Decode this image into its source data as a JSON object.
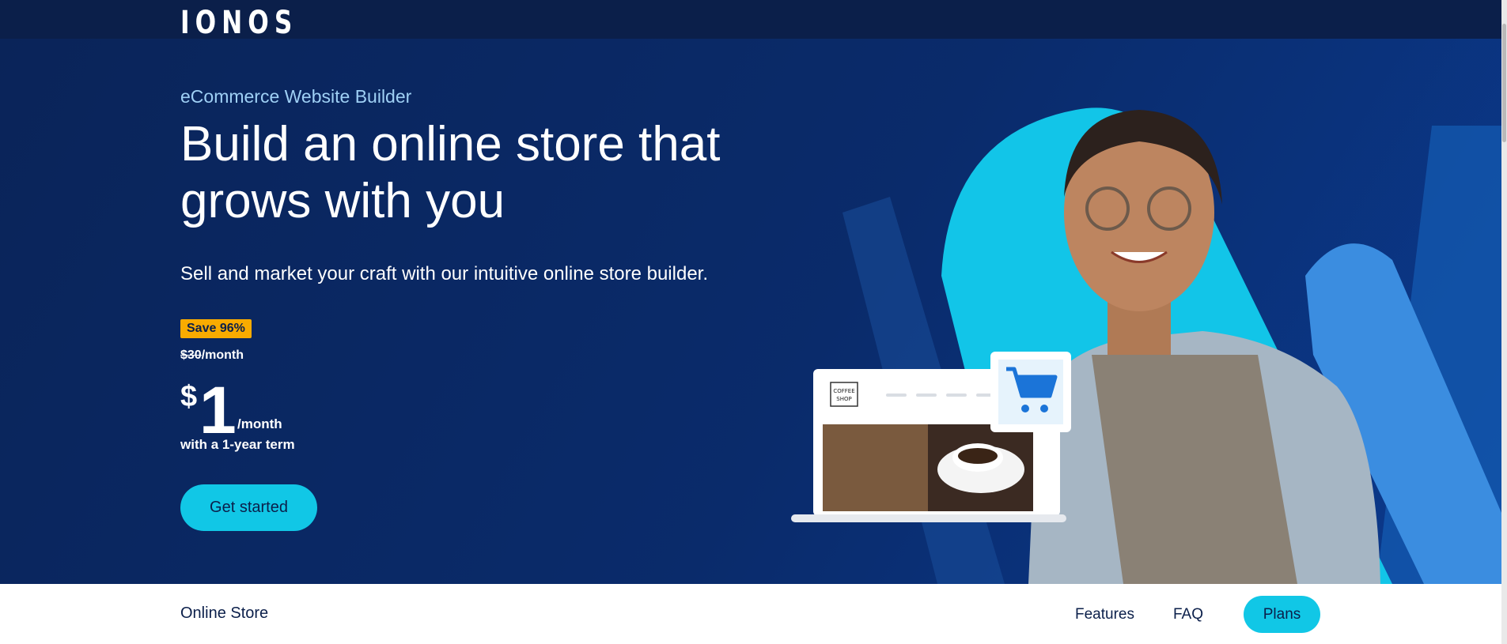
{
  "header": {
    "logo_text": "IONOS"
  },
  "hero": {
    "eyebrow": "eCommerce Website Builder",
    "headline": "Build an online store that grows with you",
    "subheadline": "Sell and market your craft with our intuitive online store builder.",
    "badge": "Save 96%",
    "old_price": "$30",
    "old_price_period": "/month",
    "price_currency": "$",
    "price_amount": "1",
    "price_period": "/month",
    "term": "with a 1-year term",
    "cta_label": "Get started"
  },
  "illustration": {
    "shop_logo_line1": "COFFEE",
    "shop_logo_line2": "SHOP"
  },
  "subnav": {
    "title": "Online Store",
    "links": [
      "Features",
      "FAQ"
    ],
    "plans_label": "Plans"
  },
  "colors": {
    "accent": "#11c7e6",
    "badge": "#f9ab00",
    "dark": "#0b1f4a"
  }
}
